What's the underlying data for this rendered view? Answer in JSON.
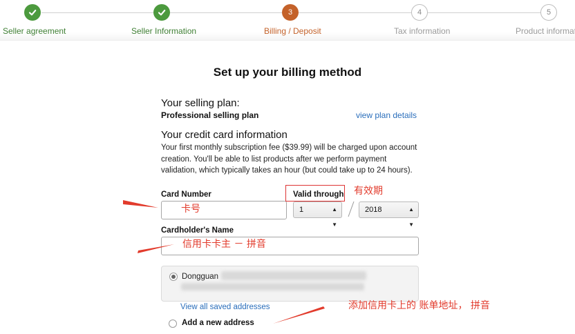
{
  "progress": {
    "steps": [
      {
        "label": "Seller agreement",
        "state": "done",
        "icon": "check-icon"
      },
      {
        "label": "Seller Information",
        "state": "done",
        "icon": "check-icon"
      },
      {
        "label": "Billing / Deposit",
        "state": "current",
        "number": "3"
      },
      {
        "label": "Tax information",
        "state": "todo",
        "number": "4"
      },
      {
        "label": "Product informati",
        "state": "todo",
        "number": "5"
      }
    ],
    "colors": {
      "done": "#4c9a3e",
      "current": "#c4622a",
      "todo": "#bdbdbd"
    }
  },
  "page": {
    "title": "Set up your billing method",
    "plan_heading": "Your selling plan:",
    "plan_name": "Professional selling plan",
    "plan_link": "view plan details",
    "card_heading": "Your credit card information",
    "card_description": "Your first monthly subscription fee ($39.99) will be charged upon account creation. You'll be able to list products after we perform payment validation, which typically takes an hour (but could take up to 24 hours)."
  },
  "form": {
    "card_number_label": "Card Number",
    "valid_through_label": "Valid through",
    "month_value": "1",
    "year_value": "2018",
    "cardholder_label": "Cardholder's Name",
    "saved_address_text": "Dongguan",
    "view_addresses_link": "View all saved addresses",
    "new_address_label": "Add a new address"
  },
  "annotations": {
    "expiry": "有效期",
    "card_number": "卡号",
    "cardholder": "信用卡卡主 － 拼音",
    "billing_address": "添加信用卡上的 账单地址，  拼音",
    "color": "#e23b2c"
  }
}
